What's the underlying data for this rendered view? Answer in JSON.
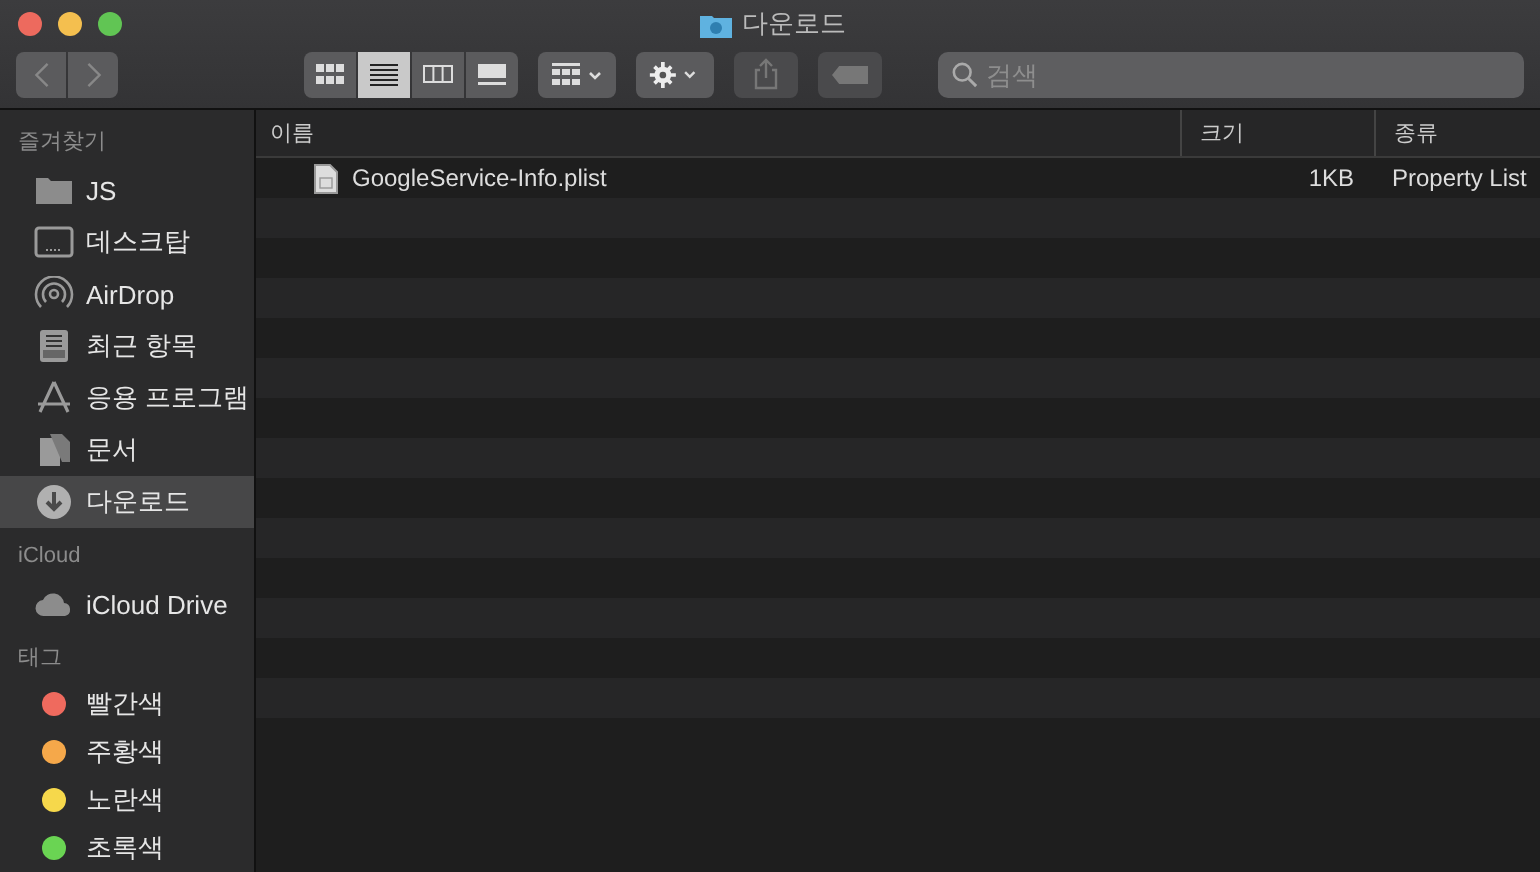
{
  "window": {
    "title": "다운로드"
  },
  "view_modes": [
    {
      "kind": "icons",
      "selected": false
    },
    {
      "kind": "list",
      "selected": true
    },
    {
      "kind": "columns",
      "selected": false
    },
    {
      "kind": "gallery",
      "selected": false
    }
  ],
  "search": {
    "placeholder": "검색"
  },
  "sidebar": {
    "sections": [
      {
        "title": "즐겨찾기",
        "items": [
          {
            "label": "JS",
            "kind": "folder",
            "selected": false
          },
          {
            "label": "데스크탑",
            "kind": "desktop",
            "selected": false
          },
          {
            "label": "AirDrop",
            "kind": "airdrop",
            "selected": false
          },
          {
            "label": "최근 항목",
            "kind": "recents",
            "selected": false
          },
          {
            "label": "응용 프로그램",
            "kind": "apps",
            "selected": false
          },
          {
            "label": "문서",
            "kind": "documents",
            "selected": false
          },
          {
            "label": "다운로드",
            "kind": "downloads",
            "selected": true
          }
        ]
      },
      {
        "title": "iCloud",
        "items": [
          {
            "label": "iCloud Drive",
            "kind": "cloud",
            "selected": false
          }
        ]
      },
      {
        "title": "태그",
        "items": [
          {
            "label": "빨간색",
            "kind": "tag",
            "color": "#ef6a5e",
            "selected": false
          },
          {
            "label": "주황색",
            "kind": "tag",
            "color": "#f5a84a",
            "selected": false
          },
          {
            "label": "노란색",
            "kind": "tag",
            "color": "#f6d84b",
            "selected": false
          },
          {
            "label": "초록색",
            "kind": "tag",
            "color": "#6ad453",
            "selected": false
          }
        ]
      }
    ]
  },
  "table": {
    "columns": [
      "이름",
      "크기",
      "종류"
    ],
    "rows": [
      {
        "name": "GoogleService-Info.plist",
        "size": "1KB",
        "kind": "Property List"
      }
    ]
  }
}
